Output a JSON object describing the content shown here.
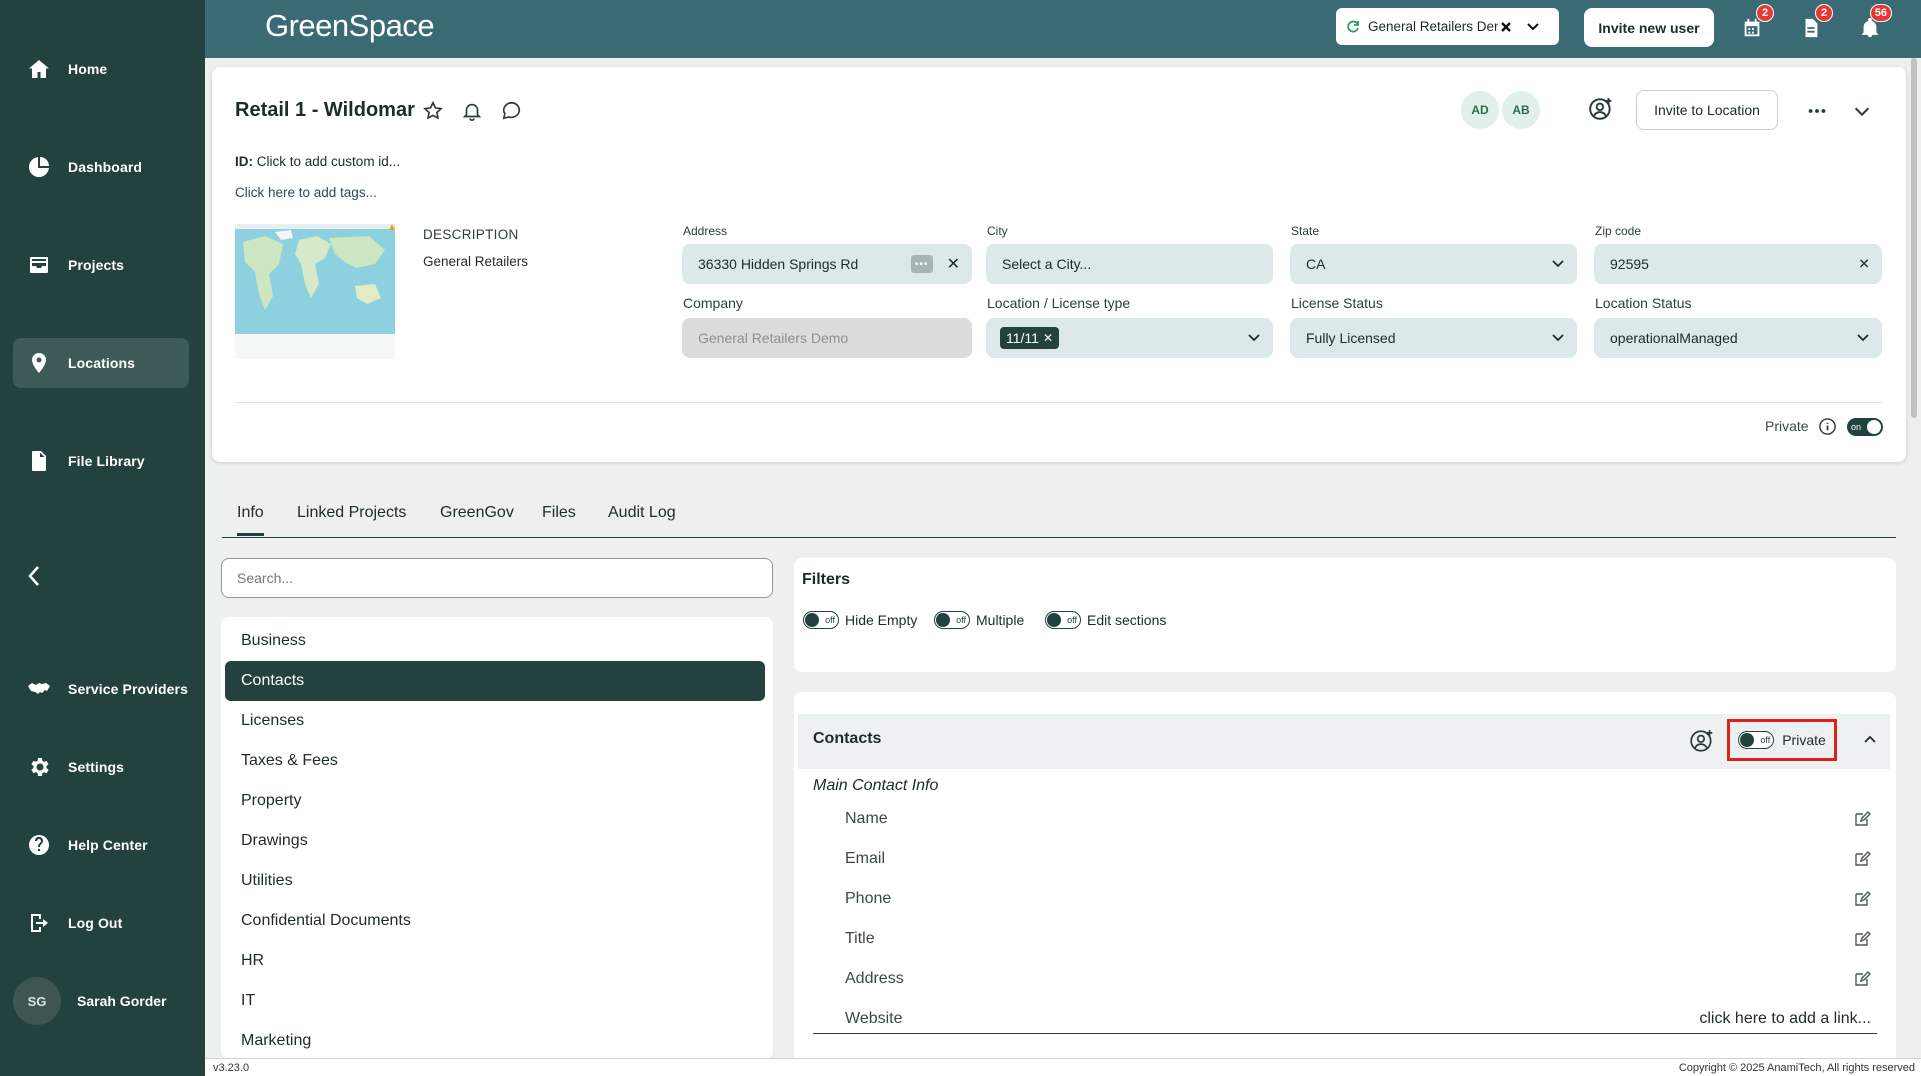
{
  "sidebar": {
    "items": [
      {
        "label": "Home",
        "icon": "home-icon"
      },
      {
        "label": "Dashboard",
        "icon": "pie-chart-icon"
      },
      {
        "label": "Projects",
        "icon": "inbox-icon"
      },
      {
        "label": "Locations",
        "icon": "map-pin-icon"
      },
      {
        "label": "File Library",
        "icon": "file-icon"
      },
      {
        "label": "Service Providers",
        "icon": "handshake-icon"
      },
      {
        "label": "Settings",
        "icon": "gear-icon"
      },
      {
        "label": "Help Center",
        "icon": "help-icon"
      },
      {
        "label": "Log Out",
        "icon": "logout-icon"
      }
    ],
    "active": "Locations",
    "user": {
      "initials": "SG",
      "name": "Sarah Gorder"
    }
  },
  "topbar": {
    "logo": "GreenSpace",
    "org_select": "General Retailers Demo",
    "invite_user": "Invite new user",
    "badges": {
      "calendar": "2",
      "documents": "2",
      "notifications": "56"
    }
  },
  "location": {
    "title": "Retail 1 - Wildomar",
    "id_label": "ID:",
    "id_placeholder": "Click to add custom id...",
    "tags_placeholder": "Click here to add tags...",
    "avatars": [
      "AD",
      "AB"
    ],
    "invite_to_location": "Invite to Location",
    "description_label": "DESCRIPTION",
    "description": "General Retailers",
    "fields": {
      "address": {
        "label": "Address",
        "value": "36330 Hidden Springs Rd"
      },
      "city": {
        "label": "City",
        "placeholder": "Select a City..."
      },
      "state": {
        "label": "State",
        "value": "CA"
      },
      "zip": {
        "label": "Zip code",
        "value": "92595"
      },
      "company": {
        "label": "Company",
        "value": "General Retailers Demo"
      },
      "license_type": {
        "label": "Location / License type",
        "chip": "11/11"
      },
      "license_status": {
        "label": "License Status",
        "value": "Fully Licensed"
      },
      "location_status": {
        "label": "Location Status",
        "value": "operationalManaged"
      }
    },
    "private_label": "Private",
    "private_state": "on"
  },
  "tabs": [
    "Info",
    "Linked Projects",
    "GreenGov",
    "Files",
    "Audit Log"
  ],
  "active_tab": "Info",
  "search": {
    "placeholder": "Search..."
  },
  "sections": [
    "Business",
    "Contacts",
    "Licenses",
    "Taxes & Fees",
    "Property",
    "Drawings",
    "Utilities",
    "Confidential Documents",
    "HR",
    "IT",
    "Marketing"
  ],
  "active_section": "Contacts",
  "filters": {
    "title": "Filters",
    "items": [
      {
        "label": "Hide Empty",
        "state": "off"
      },
      {
        "label": "Multiple",
        "state": "off"
      },
      {
        "label": "Edit sections",
        "state": "off"
      }
    ]
  },
  "contacts": {
    "title": "Contacts",
    "private_label": "Private",
    "private_state": "off",
    "group_title": "Main Contact Info",
    "fields": [
      "Name",
      "Email",
      "Phone",
      "Title",
      "Address",
      "Website"
    ],
    "website_link": "click here to add a link..."
  },
  "footer": {
    "version": "v3.23.0",
    "copyright": "Copyright © 2025 AnamiTech, All rights reserved"
  },
  "colors": {
    "sidebar": "#23413f",
    "topbar": "#3a6b74",
    "highlight": "#e0201b"
  }
}
